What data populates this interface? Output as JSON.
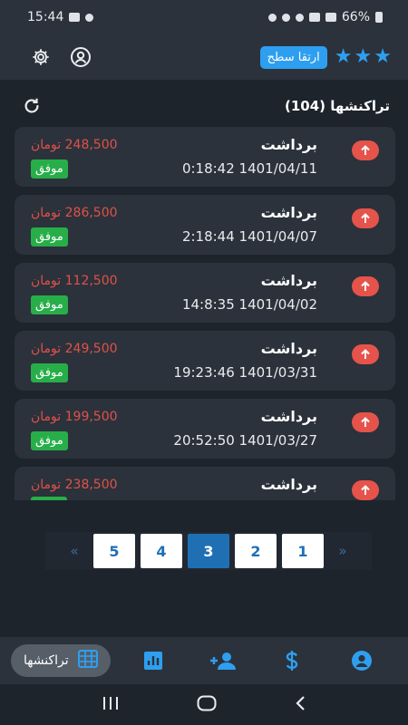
{
  "status_bar": {
    "time": "15:44",
    "battery": "66%"
  },
  "header": {
    "upgrade_label": "ارتقا سطح",
    "stars": [
      "★",
      "★",
      "★"
    ]
  },
  "transactions": {
    "title": "تراکنشها (104)",
    "items": [
      {
        "type": "برداشت",
        "datetime": "0:18:42 1401/04/11",
        "amount": "248,500 تومان",
        "status": "موفق"
      },
      {
        "type": "برداشت",
        "datetime": "2:18:44 1401/04/07",
        "amount": "286,500 تومان",
        "status": "موفق"
      },
      {
        "type": "برداشت",
        "datetime": "14:8:35 1401/04/02",
        "amount": "112,500 تومان",
        "status": "موفق"
      },
      {
        "type": "برداشت",
        "datetime": "19:23:46 1401/03/31",
        "amount": "249,500 تومان",
        "status": "موفق"
      },
      {
        "type": "برداشت",
        "datetime": "20:52:50 1401/03/27",
        "amount": "199,500 تومان",
        "status": "موفق"
      },
      {
        "type": "برداشت",
        "datetime": "",
        "amount": "238,500 تومان",
        "status": ""
      }
    ]
  },
  "pagination": {
    "prev": "«",
    "next": "»",
    "pages": [
      "5",
      "4",
      "3",
      "2",
      "1"
    ],
    "active_page": "3"
  },
  "bottom_nav": {
    "transactions_label": "تراکنشها"
  },
  "colors": {
    "accent": "#2e9ff0",
    "success": "#27ae49",
    "danger": "#e0514a",
    "card": "#2b323b",
    "background": "#1e242c"
  },
  "icons": {
    "settings": "gear-icon",
    "profile": "user-circle-icon",
    "refresh": "refresh-icon",
    "withdraw": "arrow-up-icon",
    "nav_transactions": "table-icon",
    "nav_stats": "bar-chart-icon",
    "nav_add_user": "user-plus-icon",
    "nav_money": "dollar-icon",
    "nav_account": "user-circle-icon"
  }
}
